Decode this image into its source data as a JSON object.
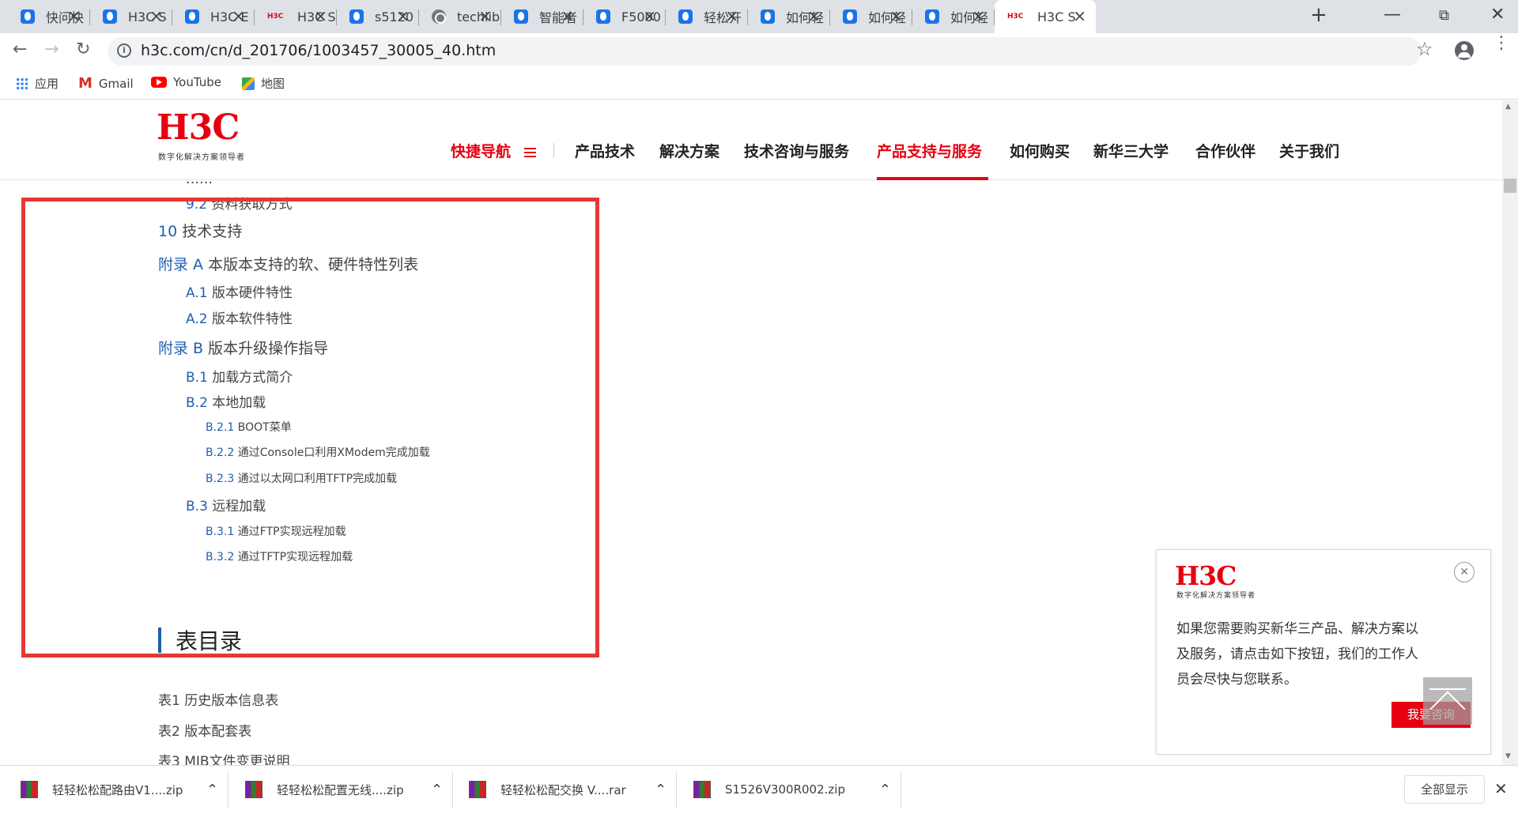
{
  "browser": {
    "tabs": [
      {
        "title": "快问快",
        "icon": "page-icon"
      },
      {
        "title": "H3C S",
        "icon": "page-icon"
      },
      {
        "title": "H3C E",
        "icon": "page-icon"
      },
      {
        "title": "H3C S",
        "icon": "h3c-icon"
      },
      {
        "title": "s5120",
        "icon": "page-icon"
      },
      {
        "title": "techlib",
        "icon": "globe-icon"
      },
      {
        "title": "智能者",
        "icon": "page-icon"
      },
      {
        "title": "F5000",
        "icon": "page-icon"
      },
      {
        "title": "轻松开",
        "icon": "page-icon"
      },
      {
        "title": "如何轻",
        "icon": "page-icon"
      },
      {
        "title": "如何轻",
        "icon": "page-icon"
      },
      {
        "title": "如何轻",
        "icon": "page-icon"
      },
      {
        "title": "H3C S",
        "icon": "h3c-icon",
        "active": true
      }
    ],
    "url": "h3c.com/cn/d_201706/1003457_30005_40.htm",
    "bookmarks": [
      {
        "label": "应用",
        "icon": "apps-icon"
      },
      {
        "label": "Gmail",
        "icon": "gmail-icon"
      },
      {
        "label": "YouTube",
        "icon": "youtube-icon"
      },
      {
        "label": "地图",
        "icon": "maps-icon"
      }
    ]
  },
  "site": {
    "logo": "H3C",
    "slogan": "数字化解决方案领导者",
    "quick_nav": "快捷导航",
    "nav": [
      "产品技术",
      "解决方案",
      "技术咨询与服务",
      "产品支持与服务",
      "如何购买",
      "新华三大学",
      "合作伙伴",
      "关于我们"
    ],
    "active_nav": "产品支持与服务",
    "accent_color": "#e60012"
  },
  "toc": {
    "partial_top": "9.2 资料获取方式",
    "items": [
      {
        "num": "10",
        "text": "技术支持",
        "level": 1
      },
      {
        "num": "附录 A",
        "text": "本版本支持的软、硬件特性列表",
        "level": 1
      },
      {
        "num": "A.1",
        "text": "版本硬件特性",
        "level": 2
      },
      {
        "num": "A.2",
        "text": "版本软件特性",
        "level": 2
      },
      {
        "num": "附录 B",
        "text": "版本升级操作指导",
        "level": 1
      },
      {
        "num": "B.1",
        "text": "加载方式简介",
        "level": 2
      },
      {
        "num": "B.2",
        "text": "本地加载",
        "level": 2
      },
      {
        "num": "B.2.1",
        "text": "BOOT菜单",
        "level": 3
      },
      {
        "num": "B.2.2",
        "text": "通过Console口利用XModem完成加载",
        "level": 3
      },
      {
        "num": "B.2.3",
        "text": "通过以太网口利用TFTP完成加载",
        "level": 3
      },
      {
        "num": "B.3",
        "text": "远程加载",
        "level": 2
      },
      {
        "num": "B.3.1",
        "text": "通过FTP实现远程加载",
        "level": 3
      },
      {
        "num": "B.3.2",
        "text": "通过TFTP实现远程加载",
        "level": 3
      }
    ],
    "section_title": "表目录",
    "tables": [
      {
        "num": "表1",
        "text": "历史版本信息表"
      },
      {
        "num": "表2",
        "text": "版本配套表"
      },
      {
        "num": "表3",
        "text": "MIB文件变更说明"
      }
    ]
  },
  "popup": {
    "logo": "H3C",
    "slogan": "数字化解决方案领导者",
    "lines": [
      "如果您需要购买新华三产品、解决方案以",
      "及服务，请点击如下按钮，我们的工作人",
      "员会尽快与您联系。"
    ],
    "button": "我要咨询"
  },
  "downloads": {
    "items": [
      "轻轻松松配路由V1....zip",
      "轻轻松松配置无线....zip",
      "轻轻松松配交换 V....rar",
      "S1526V300R002.zip"
    ],
    "show_all": "全部显示"
  },
  "highlight_color": "#e53935"
}
